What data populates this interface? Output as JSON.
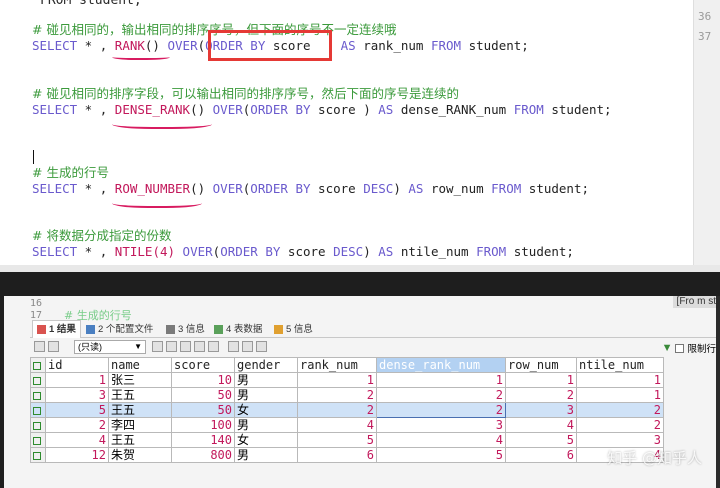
{
  "editor": {
    "cut_line": "FROM student;",
    "gutter_lines": [
      "36",
      "37"
    ],
    "blocks": [
      {
        "comment": "# 碰见相同的，输出相同的排序序号，但下面的序号不一定连续哦",
        "select": "SELECT",
        "star": " * , ",
        "func": "RANK",
        "args": "()",
        "over": "OVER",
        "paren_open": "(",
        "order": "ORDER BY",
        "col": " score ",
        "desc": "",
        "paren_close": "",
        "as": " AS",
        "alias": " rank_num ",
        "from": "FROM",
        "table": " student;"
      },
      {
        "comment": "# 碰见相同的排序字段，可以输出相同的排序序号，然后下面的序号是连续的",
        "select": "SELECT",
        "star": " * , ",
        "func": "DENSE_RANK",
        "args": "()",
        "over": "OVER",
        "paren_open": "(",
        "order": "ORDER BY",
        "col": " score ",
        "desc": "",
        "paren_close": ")",
        "as": " AS",
        "alias": " dense_RANK_num ",
        "from": "FROM",
        "table": " student;"
      },
      {
        "comment": "# 生成的行号",
        "select": "SELECT",
        "star": " * , ",
        "func": "ROW_NUMBER",
        "args": "()",
        "over": "OVER",
        "paren_open": "(",
        "order": "ORDER BY",
        "col": " score ",
        "desc": "DESC",
        "paren_close": ")",
        "as": " AS",
        "alias": " row_num ",
        "from": "FROM",
        "table": " student;"
      },
      {
        "comment": "# 将数据分成指定的份数",
        "select": "SELECT",
        "star": " * , ",
        "func": "NTILE",
        "args": "(4)",
        "over": "OVER",
        "paren_open": "(",
        "order": "ORDER BY",
        "col": " score ",
        "desc": "DESC",
        "paren_close": ")",
        "as": " AS",
        "alias": " ntile_num ",
        "from": "FROM",
        "table": " student;"
      }
    ]
  },
  "panel": {
    "line_numbers": [
      "16",
      "17"
    ],
    "ghost_comment": "# 生成的行号",
    "ghost_status": "[Fro m st",
    "tabs": [
      "1 结果",
      "2 个配置文件",
      "3 信息",
      "4 表数据",
      "5 信息"
    ],
    "select_value": "(只读)",
    "limit_label": "限制行"
  },
  "grid": {
    "columns": [
      "id",
      "name",
      "score",
      "gender",
      "rank_num",
      "dense_rank_num",
      "row_num",
      "ntile_num"
    ],
    "rows": [
      [
        "1",
        "张三",
        "10",
        "男",
        "1",
        "1",
        "1",
        "1"
      ],
      [
        "3",
        "王五",
        "50",
        "男",
        "2",
        "2",
        "2",
        "1"
      ],
      [
        "5",
        "王五",
        "50",
        "女",
        "2",
        "2",
        "3",
        "2"
      ],
      [
        "2",
        "李四",
        "100",
        "男",
        "4",
        "3",
        "4",
        "2"
      ],
      [
        "4",
        "王五",
        "140",
        "女",
        "5",
        "4",
        "5",
        "3"
      ],
      [
        "12",
        "朱贺",
        "800",
        "男",
        "6",
        "5",
        "6",
        "4"
      ]
    ]
  },
  "watermark": "知乎 @知乎人"
}
